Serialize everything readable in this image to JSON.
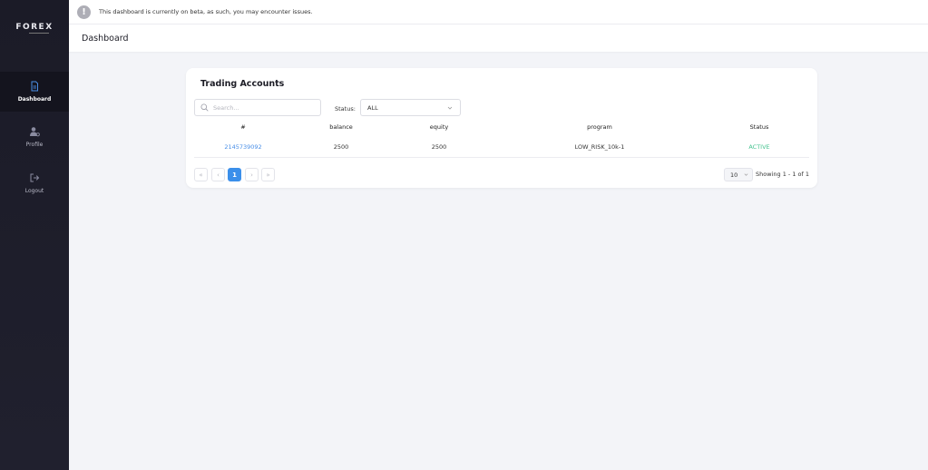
{
  "sidebar": {
    "logo": "FOREX",
    "items": [
      {
        "label": "Dashboard",
        "active": true
      },
      {
        "label": "Profile",
        "active": false
      },
      {
        "label": "Logout",
        "active": false
      }
    ]
  },
  "banner": {
    "icon": "!",
    "text": "This dashboard is currently on beta, as such, you may encounter issues."
  },
  "header": {
    "title": "Dashboard"
  },
  "card": {
    "title": "Trading Accounts",
    "search_placeholder": "Search...",
    "status_label": "Status:",
    "status_value": "ALL",
    "columns": [
      "#",
      "balance",
      "equity",
      "program",
      "Status"
    ],
    "rows": [
      {
        "id": "2145739092",
        "balance": "2500",
        "equity": "2500",
        "program": "LOW_RISK_10k-1",
        "status": "ACTIVE"
      }
    ],
    "pagination": {
      "first": "«",
      "prev": "‹",
      "current": "1",
      "next": "›",
      "last": "»"
    },
    "page_size": "10",
    "showing": "Showing 1 - 1 of 1"
  },
  "colors": {
    "sidebar_bg": "#1b1b27",
    "accent": "#3b8fea",
    "link": "#4a8fe7",
    "active_status": "#46c390",
    "page_bg": "#f3f4f8"
  }
}
